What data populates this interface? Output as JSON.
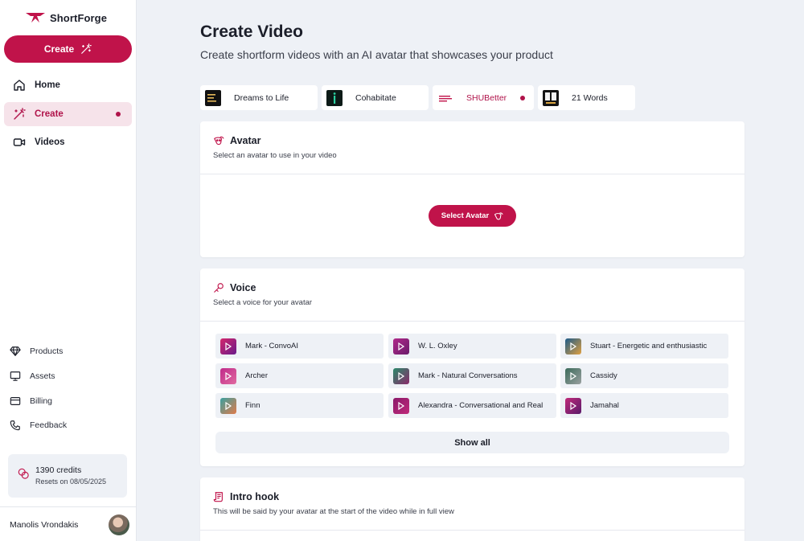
{
  "brand": {
    "name": "ShortForge",
    "accent": "#c0134a"
  },
  "sidebar": {
    "create_label": "Create",
    "nav": [
      {
        "label": "Home",
        "icon": "home-icon"
      },
      {
        "label": "Create",
        "icon": "wand-icon"
      },
      {
        "label": "Videos",
        "icon": "video-icon"
      }
    ],
    "secondary": [
      {
        "label": "Products",
        "icon": "diamond-icon"
      },
      {
        "label": "Assets",
        "icon": "monitor-icon"
      },
      {
        "label": "Billing",
        "icon": "card-icon"
      },
      {
        "label": "Feedback",
        "icon": "phone-icon"
      }
    ],
    "credits": {
      "amount": "1390 credits",
      "reset": "Resets on 08/05/2025"
    },
    "user": {
      "name": "Manolis Vrondakis"
    }
  },
  "main": {
    "title": "Create Video",
    "subtitle": "Create shortform videos with an AI avatar that showcases your product",
    "products": [
      {
        "label": "Dreams to Life"
      },
      {
        "label": "Cohabitate"
      },
      {
        "label": "SHUBetter"
      },
      {
        "label": "21 Words"
      }
    ],
    "avatar_card": {
      "title": "Avatar",
      "desc": "Select an avatar to use in your video",
      "button": "Select Avatar"
    },
    "voice_card": {
      "title": "Voice",
      "desc": "Select a voice for your avatar",
      "voices": [
        "Mark - ConvoAI",
        "W. L. Oxley",
        "Stuart - Energetic and enthusiastic",
        "Archer",
        "Mark - Natural Conversations",
        "Cassidy",
        "Finn",
        "Alexandra - Conversational and Real",
        "Jamahal"
      ],
      "show_all": "Show all"
    },
    "intro_card": {
      "title": "Intro hook",
      "desc": "This will be said by your avatar at the start of the video while in full view"
    }
  }
}
